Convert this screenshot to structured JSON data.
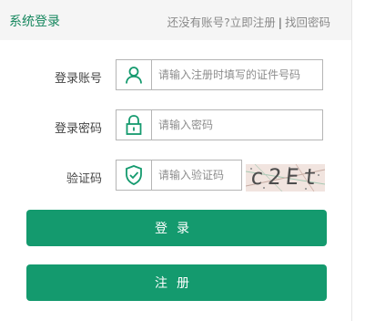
{
  "header": {
    "title": "系统登录",
    "no_account": "还没有账号?",
    "register_link": "立即注册",
    "separator": "|",
    "recover_link": "找回密码"
  },
  "account": {
    "label": "登录账号",
    "placeholder": "请输入注册时填写的证件号码",
    "icon": "user-icon"
  },
  "password": {
    "label": "登录密码",
    "placeholder": "请输入密码",
    "icon": "lock-icon"
  },
  "captcha": {
    "label": "验证码",
    "placeholder": "请输入验证码",
    "icon": "shield-check-icon",
    "image_text": "c2Et"
  },
  "buttons": {
    "login": "登录",
    "register": "注册"
  },
  "colors": {
    "accent": "#149a6e",
    "title": "#16875e"
  }
}
